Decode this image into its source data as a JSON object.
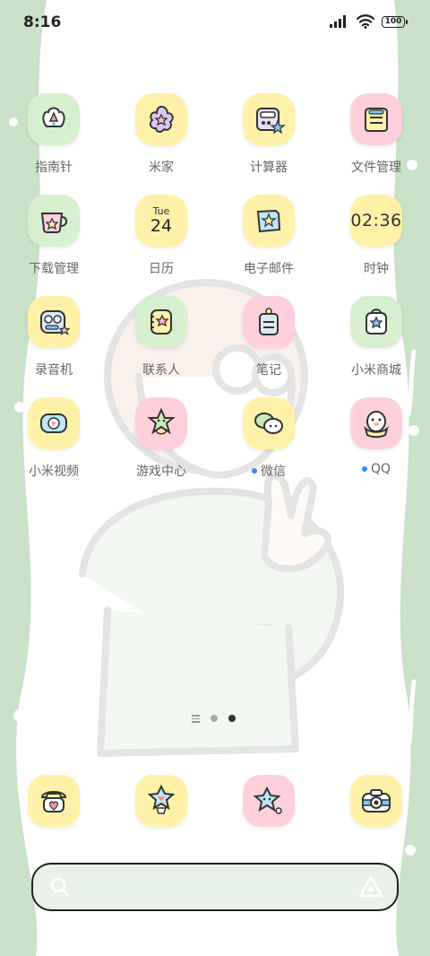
{
  "status_bar": {
    "time": "8:16",
    "icons": [
      "cellular-signal-icon",
      "wifi-icon",
      "battery-icon"
    ],
    "battery": "100"
  },
  "apps": {
    "row1": [
      {
        "label": "指南针",
        "icon": "compass-icon"
      },
      {
        "label": "米家",
        "icon": "mihome-icon"
      },
      {
        "label": "计算器",
        "icon": "calculator-icon"
      },
      {
        "label": "文件管理",
        "icon": "file-manager-icon"
      }
    ],
    "row2": [
      {
        "label": "下载管理",
        "icon": "download-manager-icon"
      },
      {
        "label": "日历",
        "icon": "calendar-icon",
        "day": "Tue",
        "date": "24"
      },
      {
        "label": "电子邮件",
        "icon": "email-icon"
      },
      {
        "label": "时钟",
        "icon": "clock-icon",
        "time": "02:36"
      }
    ],
    "row3": [
      {
        "label": "录音机",
        "icon": "recorder-icon"
      },
      {
        "label": "联系人",
        "icon": "contacts-icon"
      },
      {
        "label": "笔记",
        "icon": "notes-icon"
      },
      {
        "label": "小米商城",
        "icon": "mi-store-icon"
      }
    ],
    "row4": [
      {
        "label": "小米视频",
        "icon": "mi-video-icon"
      },
      {
        "label": "游戏中心",
        "icon": "game-center-icon"
      },
      {
        "label": "微信",
        "icon": "wechat-icon",
        "badge": "new-dot"
      },
      {
        "label": "QQ",
        "icon": "qq-icon",
        "badge": "new-dot"
      }
    ]
  },
  "page_indicator": {
    "pages": 2,
    "active": 2
  },
  "dock": [
    {
      "icon": "phone-icon"
    },
    {
      "icon": "messages-icon"
    },
    {
      "icon": "browser-icon"
    },
    {
      "icon": "camera-icon"
    }
  ],
  "search_bar": {
    "placeholder": ""
  },
  "colors": {
    "wallpaper_green": "#c9e2c8",
    "tile_yellow": "#fff1a8",
    "tile_pink": "#ffd0dc",
    "tile_green": "#d7f0cf",
    "notification_dot": "#3a86ff"
  }
}
